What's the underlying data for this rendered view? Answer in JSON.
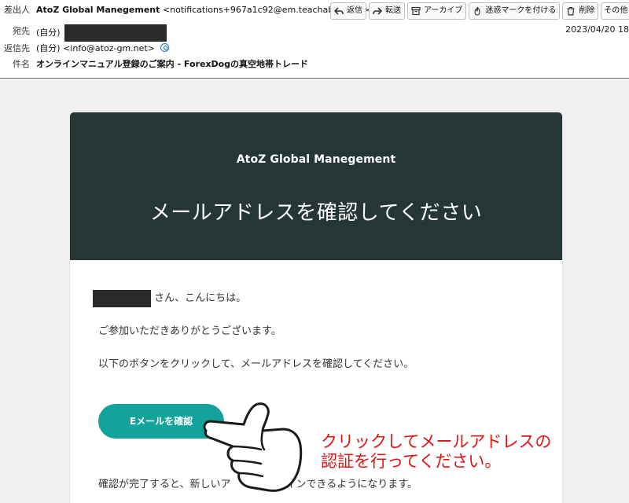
{
  "header": {
    "from_label": "差出人",
    "from_name": "AtoZ Global Manegement",
    "from_address": "<notifications+967a1c92@em.teachable.com>",
    "to_label": "宛先",
    "to_value": "(自分)",
    "replyto_label": "返信先",
    "replyto_value": "(自分) <info@atoz-gm.net>",
    "subject_label": "件名",
    "subject_value": "オンラインマニュアル登録のご案内 - ForexDogの真空地帯トレード",
    "date": "2023/04/20 18"
  },
  "toolbar": {
    "reply": "返信",
    "forward": "転送",
    "archive": "アーカイブ",
    "junk": "迷惑マークを付ける",
    "delete": "削除",
    "more": "その他"
  },
  "email": {
    "brand": "AtoZ Global Manegement",
    "headline": "メールアドレスを確認してください",
    "greeting": "さん、こんにちは。",
    "thanks": "ご参加いただきありがとうございます。",
    "instruction": "以下のボタンをクリックして、メールアドレスを確認してください。",
    "button": "Eメールを確認",
    "footer_visible_start": "確認が完了すると、新しいア",
    "footer_visible_end": "インできるようになります。"
  },
  "annotation": {
    "line1": "クリックしてメールアドレスの",
    "line2": "認証を行ってください。"
  },
  "colors": {
    "banner": "#263636",
    "button": "#14a39a",
    "annotation_text": "#e01212"
  },
  "icons": [
    "contact-icon",
    "reply-icon",
    "forward-icon",
    "archive-icon",
    "junk-icon",
    "trash-icon",
    "pointing-hand-icon"
  ]
}
